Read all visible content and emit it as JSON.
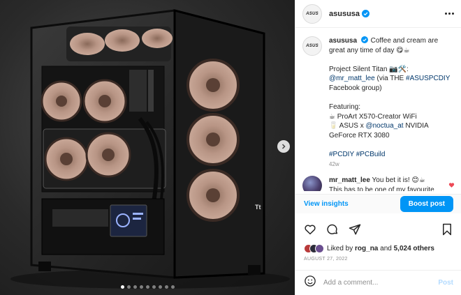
{
  "post": {
    "username": "asususa",
    "avatar_logo": "ASUS",
    "more_icon": "more-horizontal-icon"
  },
  "caption": {
    "username": "asususa",
    "line1": "Coffee and cream are great any time of day 😋☕",
    "project": "Project Silent Titan 📷🛠️:",
    "credit_user": "@mr_matt_lee",
    "credit_via": " (via THE ",
    "credit_tag": "#ASUSPCDIY",
    "credit_end": " Facebook group)",
    "featuring": "Featuring:",
    "feat1": "☕ ProArt X570-Creator WiFi",
    "feat2_prefix": "🥛 ASUS x ",
    "feat2_tag": "@noctua_at",
    "feat2_suffix": " NVIDIA GeForce RTX 3080",
    "hashtag1": "#PCDIY",
    "hashtag2": "#PCBuild",
    "time": "42w"
  },
  "comment": {
    "username": "mr_matt_lee",
    "text": " You bet it is! 😊☕",
    "text2": "This has to be one of my favourite"
  },
  "actions": {
    "insights_label": "View insights",
    "boost_label": "Boost post"
  },
  "likes": {
    "prefix": "Liked by ",
    "user": "rog_na",
    "middle": " and ",
    "count": "5,024 others"
  },
  "date": "AUGUST 27, 2022",
  "add_comment": {
    "placeholder": "Add a comment...",
    "post_label": "Post"
  },
  "media": {
    "case_brand": "Tt",
    "slide_count": 9,
    "active_slide": 1
  }
}
